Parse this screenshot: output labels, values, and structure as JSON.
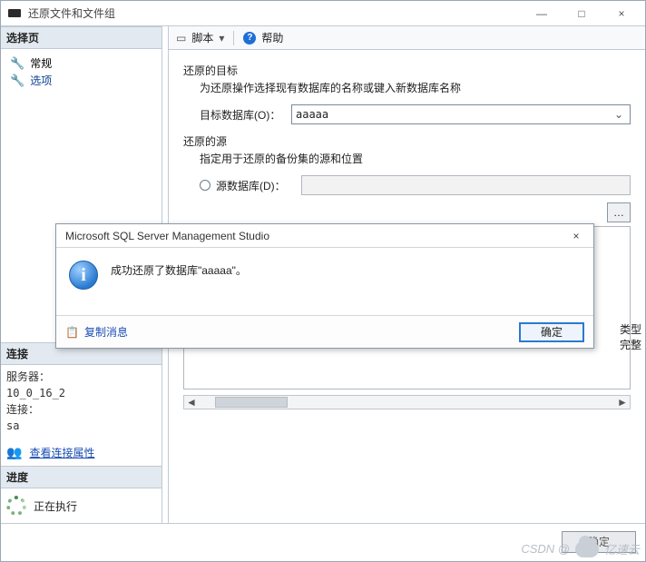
{
  "window": {
    "title": "还原文件和文件组",
    "minimize": "—",
    "maximize": "□",
    "close": "×"
  },
  "sidebar": {
    "select_pages_header": "选择页",
    "items": [
      {
        "label": "常规"
      },
      {
        "label": "选项"
      }
    ],
    "connection_header": "连接",
    "server_label": "服务器：",
    "server_value": "10_0_16_2",
    "conn_label": "连接：",
    "conn_value": "sa",
    "view_props": "查看连接属性",
    "progress_header": "进度",
    "progress_text": "正在执行"
  },
  "toolbar": {
    "script": "脚本",
    "arrow": "▾",
    "help": "帮助"
  },
  "form": {
    "target_title": "还原的目标",
    "target_sub": "为还原操作选择现有数据库的名称或键入新数据库名称",
    "target_db_label": "目标数据库(O)：",
    "target_db_value": "aaaaa",
    "source_title": "还原的源",
    "source_sub": "指定用于还原的备份集的源和位置",
    "source_db_label": "源数据库(D)：",
    "ellipsis": "…",
    "right_tag1": "类型",
    "right_tag2": "完整"
  },
  "bottom": {
    "button_label": "确定"
  },
  "modal": {
    "title": "Microsoft SQL Server Management Studio",
    "message": "成功还原了数据库\"aaaaa\"。",
    "copy": "复制消息",
    "ok": "确定",
    "close": "×",
    "info_glyph": "i"
  },
  "watermark": {
    "csdn": "CSDN @",
    "brand": "亿速云"
  }
}
